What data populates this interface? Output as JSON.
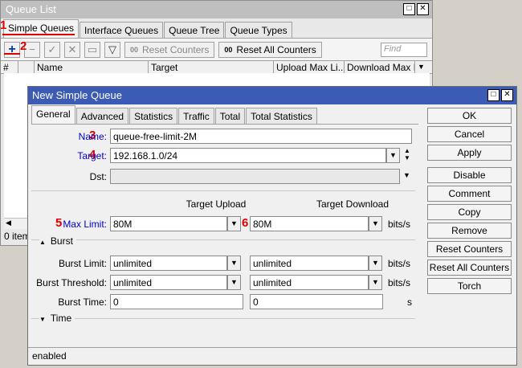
{
  "queue_list": {
    "title": "Queue List",
    "tabs": [
      "Simple Queues",
      "Interface Queues",
      "Queue Tree",
      "Queue Types"
    ],
    "toolbar": {
      "reset_counters": "Reset Counters",
      "reset_all_counters": "Reset All Counters",
      "find_placeholder": "Find",
      "counter_icon": "00"
    },
    "columns": [
      "#",
      "Name",
      "Target",
      "Upload Max Li...",
      "Download Max L..."
    ],
    "status": "0 item"
  },
  "annotations": [
    "1",
    "2",
    "3",
    "4",
    "5",
    "6"
  ],
  "new_queue": {
    "title": "New Simple Queue",
    "tabs": [
      "General",
      "Advanced",
      "Statistics",
      "Traffic",
      "Total",
      "Total Statistics"
    ],
    "labels": {
      "name": "Name:",
      "target": "Target:",
      "dst": "Dst:",
      "target_upload": "Target Upload",
      "target_download": "Target Download",
      "max_limit": "Max Limit:",
      "burst": "Burst",
      "burst_limit": "Burst Limit:",
      "burst_threshold": "Burst Threshold:",
      "burst_time": "Burst Time:",
      "time": "Time"
    },
    "values": {
      "name": "queue-free-limit-2M",
      "target": "192.168.1.0/24",
      "dst": "",
      "max_limit_upload": "80M",
      "max_limit_download": "80M",
      "burst_limit_upload": "unlimited",
      "burst_limit_download": "unlimited",
      "burst_threshold_upload": "unlimited",
      "burst_threshold_download": "unlimited",
      "burst_time_upload": "0",
      "burst_time_download": "0"
    },
    "units": {
      "bits": "bits/s",
      "seconds": "s"
    },
    "buttons": [
      "OK",
      "Cancel",
      "Apply",
      "Disable",
      "Comment",
      "Copy",
      "Remove",
      "Reset Counters",
      "Reset All Counters",
      "Torch"
    ],
    "status": "enabled"
  },
  "colors": {
    "title_active": "#3c5bb5",
    "annotation": "#e00000",
    "link": "#0000cc"
  }
}
